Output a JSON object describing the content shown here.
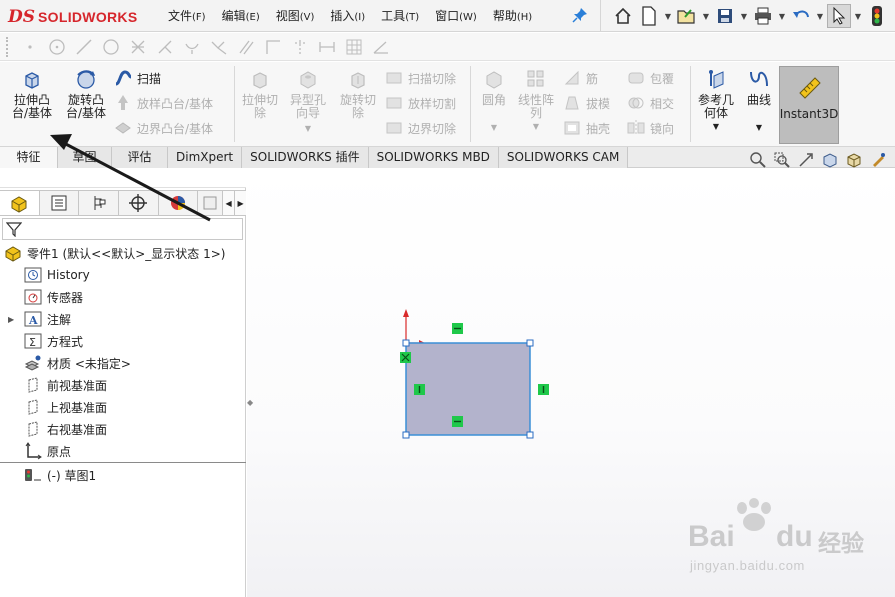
{
  "app": {
    "logo_ds": "DS",
    "brand": "SOLIDWORKS"
  },
  "menu": [
    {
      "label": "文件",
      "accel": "(F)"
    },
    {
      "label": "编辑",
      "accel": "(E)"
    },
    {
      "label": "视图",
      "accel": "(V)"
    },
    {
      "label": "插入",
      "accel": "(I)"
    },
    {
      "label": "工具",
      "accel": "(T)"
    },
    {
      "label": "窗口",
      "accel": "(W)"
    },
    {
      "label": "帮助",
      "accel": "(H)"
    }
  ],
  "quick_access_icons": [
    "home-icon",
    "new-document-icon",
    "open-icon",
    "save-icon",
    "print-icon",
    "undo-icon",
    "select-pointer-icon",
    "traffic-light-icon"
  ],
  "ribbon": {
    "extrude_boss": "拉伸凸\n台/基体",
    "revolve_boss": "旋转凸\n台/基体",
    "sweep": "扫描",
    "loft_boss": "放样凸台/基体",
    "boundary_boss": "边界凸台/基体",
    "extrude_cut": "拉伸切\n除",
    "hole_wizard": "异型孔\n向导",
    "revolve_cut": "旋转切\n除",
    "swept_cut": "扫描切除",
    "lofted_cut": "放样切割",
    "boundary_cut": "边界切除",
    "fillet": "圆角",
    "linear_pattern": "线性阵\n列",
    "rib": "筋",
    "draft": "拔模",
    "shell": "抽壳",
    "wrap": "包覆",
    "intersect": "相交",
    "mirror": "镜向",
    "ref_geometry": "参考几\n何体",
    "curves": "曲线",
    "instant3d": "Instant3D"
  },
  "tabs": [
    "特征",
    "草图",
    "评估",
    "DimXpert",
    "SOLIDWORKS 插件",
    "SOLIDWORKS MBD",
    "SOLIDWORKS CAM"
  ],
  "active_tab": "特征",
  "feature_tree": {
    "root": "零件1  (默认<<默认>_显示状态 1>)",
    "items": [
      {
        "label": "History",
        "icon": "history-icon"
      },
      {
        "label": "传感器",
        "icon": "sensor-icon"
      },
      {
        "label": "注解",
        "icon": "annotation-icon",
        "expandable": true
      },
      {
        "label": "方程式",
        "icon": "equation-icon"
      },
      {
        "label": "材质 <未指定>",
        "icon": "material-icon"
      },
      {
        "label": "前视基准面",
        "icon": "plane-icon"
      },
      {
        "label": "上视基准面",
        "icon": "plane-icon"
      },
      {
        "label": "右视基准面",
        "icon": "plane-icon"
      },
      {
        "label": "原点",
        "icon": "origin-icon"
      },
      {
        "label": "(-) 草图1",
        "icon": "sketch-icon"
      }
    ]
  },
  "colors": {
    "brand_red": "#d6262c",
    "rectangle_fill": "#b3b3cc",
    "sketch_line": "#3b8fd6",
    "relation_green": "#1fc84a",
    "annotation_arrow": "#1a1a1a"
  },
  "watermark": {
    "main": "Bai",
    "cn": "经验",
    "url": "jingyan.baidu.com"
  }
}
